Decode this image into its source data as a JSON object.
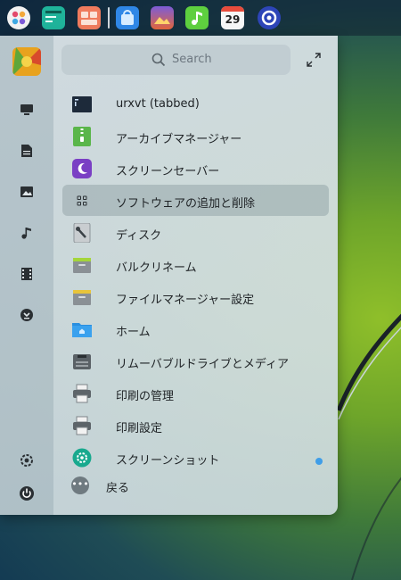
{
  "dock": {
    "calendar_day": "29",
    "items": [
      "launcher",
      "terminal",
      "files",
      "store",
      "photos",
      "music",
      "calendar",
      "settings"
    ]
  },
  "search": {
    "placeholder": "Search"
  },
  "sidebar": {
    "buttons": [
      "computer",
      "documents",
      "pictures",
      "music",
      "videos",
      "downloads"
    ],
    "bottom": [
      "settings",
      "power"
    ]
  },
  "apps": [
    {
      "label": "urxvt (tabbed)",
      "icon": "terminal-icon"
    },
    {
      "label": "アーカイブマネージャー",
      "icon": "archive-icon"
    },
    {
      "label": "スクリーンセーバー",
      "icon": "screensaver-icon"
    },
    {
      "label": "ソフトウェアの追加と削除",
      "icon": "apps-grid-icon",
      "selected": true
    },
    {
      "label": "ディスク",
      "icon": "disk-icon"
    },
    {
      "label": "バルクリネーム",
      "icon": "rename-icon"
    },
    {
      "label": "ファイルマネージャー設定",
      "icon": "filemanager-settings-icon"
    },
    {
      "label": "ホーム",
      "icon": "home-folder-icon"
    },
    {
      "label": "リムーバブルドライブとメディア",
      "icon": "removable-drive-icon"
    },
    {
      "label": "印刷の管理",
      "icon": "printer-icon"
    },
    {
      "label": "印刷設定",
      "icon": "print-settings-icon"
    },
    {
      "label": "スクリーンショット",
      "icon": "screenshot-icon",
      "new": true
    }
  ],
  "back": {
    "label": "戻る"
  },
  "colors": {
    "accent": "#3f9ee8",
    "selection": "#9aa9ae"
  }
}
